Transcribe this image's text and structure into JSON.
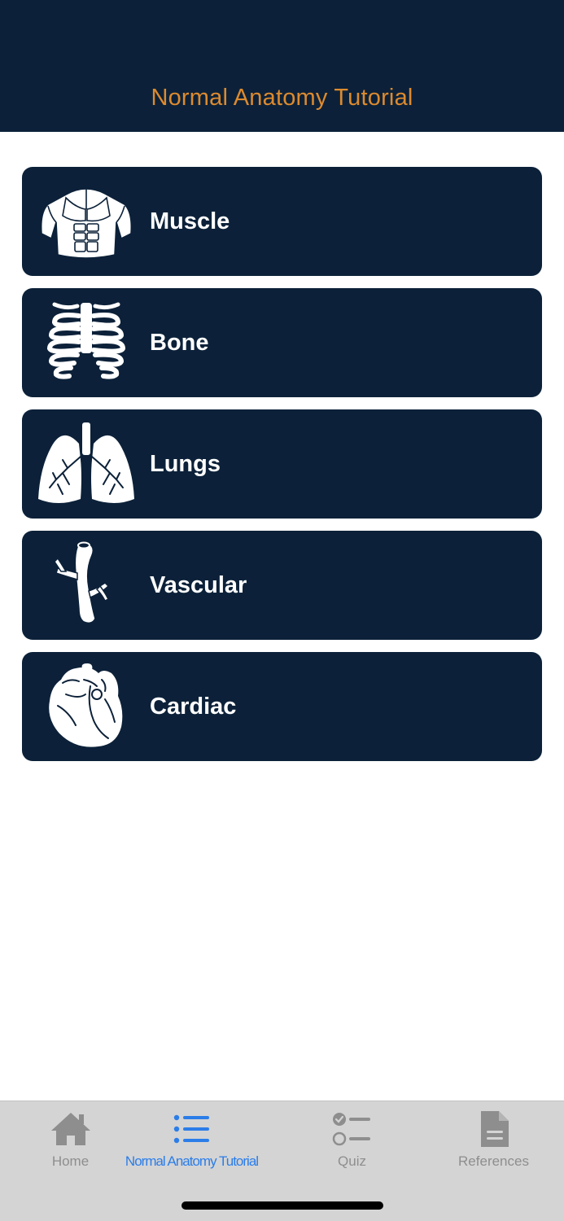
{
  "header": {
    "title": "Normal Anatomy Tutorial"
  },
  "menu": {
    "items": [
      {
        "label": "Muscle",
        "icon": "muscle-torso-icon"
      },
      {
        "label": "Bone",
        "icon": "ribcage-icon"
      },
      {
        "label": "Lungs",
        "icon": "lungs-icon"
      },
      {
        "label": "Vascular",
        "icon": "blood-vessel-icon"
      },
      {
        "label": "Cardiac",
        "icon": "heart-icon"
      }
    ]
  },
  "tabbar": {
    "tabs": [
      {
        "label": "Home",
        "icon": "home-icon",
        "active": false
      },
      {
        "label": "Normal Anatomy Tutorial",
        "icon": "list-icon",
        "active": true
      },
      {
        "label": "Quiz",
        "icon": "checklist-icon",
        "active": false
      },
      {
        "label": "References",
        "icon": "document-icon",
        "active": false
      }
    ]
  },
  "colors": {
    "navy": "#0c2139",
    "title_orange": "#dd8a2e",
    "tab_active": "#2b7de9",
    "tab_inactive": "#8e8e8e",
    "tabbar_bg": "#d4d4d4"
  }
}
